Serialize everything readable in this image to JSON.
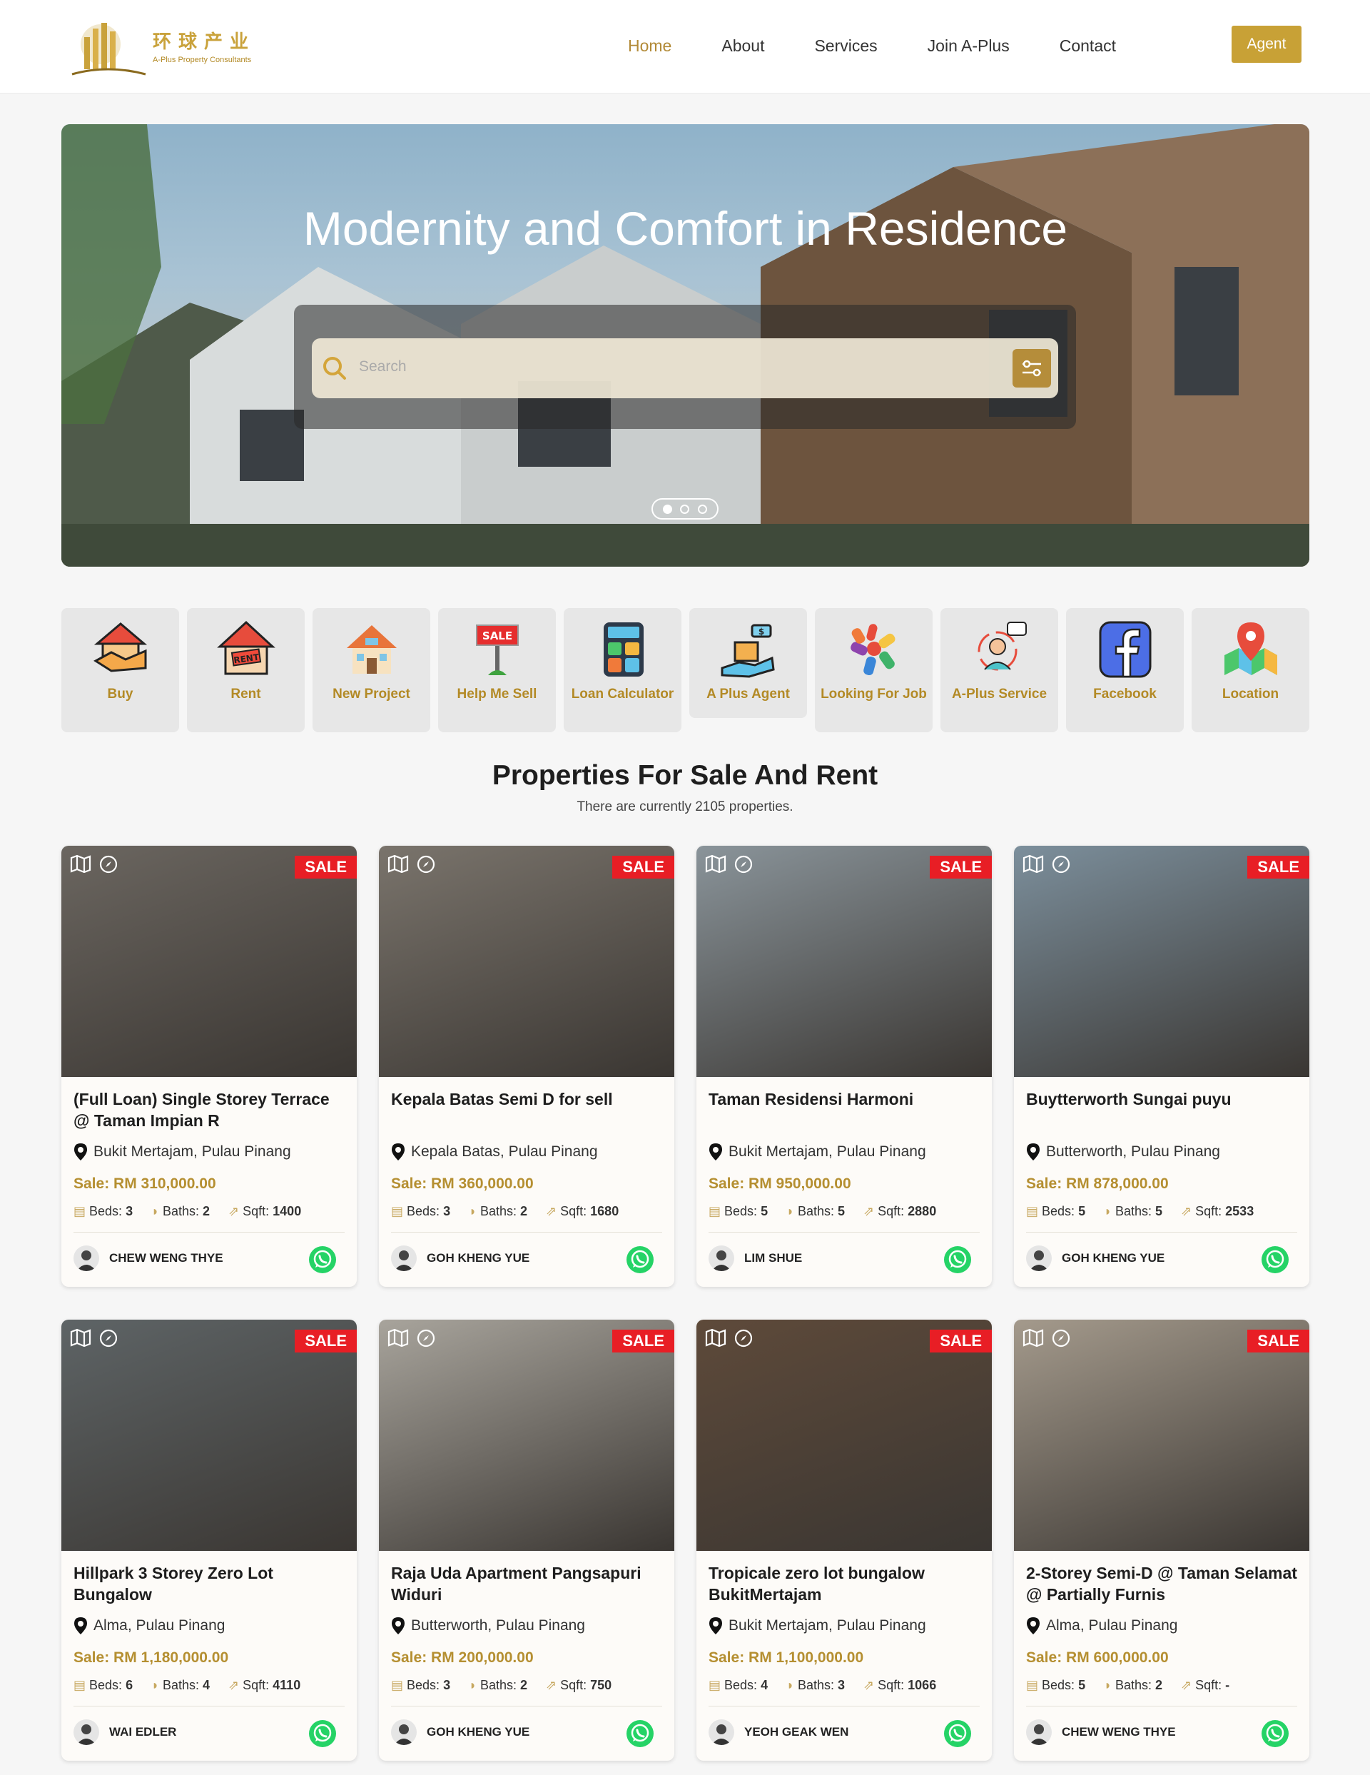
{
  "header": {
    "logo_cn": "环球产业",
    "logo_en": "A-Plus Property Consultants",
    "nav": [
      "Home",
      "About",
      "Services",
      "Join A-Plus",
      "Contact"
    ],
    "agent_button": "Agent"
  },
  "hero": {
    "title": "Modernity and Comfort in Residence",
    "search_placeholder": "Search"
  },
  "categories": [
    {
      "label": "Buy",
      "icon": "buy-icon"
    },
    {
      "label": "Rent",
      "icon": "rent-icon"
    },
    {
      "label": "New Project",
      "icon": "new-project-icon"
    },
    {
      "label": "Help Me Sell",
      "icon": "sale-sign-icon"
    },
    {
      "label": "Loan Calculator",
      "icon": "calculator-icon"
    },
    {
      "label": "A Plus Agent",
      "icon": "agent-icon"
    },
    {
      "label": "Looking For Job",
      "icon": "job-icon"
    },
    {
      "label": "A-Plus Service",
      "icon": "service-icon"
    },
    {
      "label": "Facebook",
      "icon": "facebook-icon"
    },
    {
      "label": "Location",
      "icon": "map-pin-icon"
    }
  ],
  "section": {
    "title": "Properties For Sale And Rent",
    "subtitle": "There are currently 2105 properties."
  },
  "listings": [
    {
      "tag": "SALE",
      "title": "(Full Loan) Single Storey Terrace @ Taman Impian R",
      "location": "Bukit Mertajam, Pulau Pinang",
      "price": "Sale: RM 310,000.00",
      "beds_label": "Beds:",
      "beds": "3",
      "baths_label": "Baths:",
      "baths": "2",
      "sqft_label": "Sqft:",
      "sqft": "1400",
      "agent": "CHEW WENG THYE",
      "img": "#6b6660"
    },
    {
      "tag": "SALE",
      "title": "Kepala Batas Semi D for sell",
      "location": "Kepala Batas, Pulau Pinang",
      "price": "Sale: RM 360,000.00",
      "beds_label": "Beds:",
      "beds": "3",
      "baths_label": "Baths:",
      "baths": "2",
      "sqft_label": "Sqft:",
      "sqft": "1680",
      "agent": "GOH KHENG YUE",
      "img": "#7a746c"
    },
    {
      "tag": "SALE",
      "title": "Taman Residensi Harmoni",
      "location": "Bukit Mertajam, Pulau Pinang",
      "price": "Sale: RM 950,000.00",
      "beds_label": "Beds:",
      "beds": "5",
      "baths_label": "Baths:",
      "baths": "5",
      "sqft_label": "Sqft:",
      "sqft": "2880",
      "agent": "LIM SHUE",
      "img": "#8a949a"
    },
    {
      "tag": "SALE",
      "title": "Buytterworth Sungai puyu",
      "location": "Butterworth, Pulau Pinang",
      "price": "Sale: RM 878,000.00",
      "beds_label": "Beds:",
      "beds": "5",
      "baths_label": "Baths:",
      "baths": "5",
      "sqft_label": "Sqft:",
      "sqft": "2533",
      "agent": "GOH KHENG YUE",
      "img": "#7c8f9c"
    },
    {
      "tag": "SALE",
      "title": "Hillpark 3 Storey Zero Lot Bungalow",
      "location": "Alma, Pulau Pinang",
      "price": "Sale: RM 1,180,000.00",
      "beds_label": "Beds:",
      "beds": "6",
      "baths_label": "Baths:",
      "baths": "4",
      "sqft_label": "Sqft:",
      "sqft": "4110",
      "agent": "WAI EDLER",
      "img": "#5e6466"
    },
    {
      "tag": "SALE",
      "title": "Raja Uda Apartment Pangsapuri Widuri",
      "location": "Butterworth, Pulau Pinang",
      "price": "Sale: RM 200,000.00",
      "beds_label": "Beds:",
      "beds": "3",
      "baths_label": "Baths:",
      "baths": "2",
      "sqft_label": "Sqft:",
      "sqft": "750",
      "agent": "GOH KHENG YUE",
      "img": "#a8a49c"
    },
    {
      "tag": "SALE",
      "title": "Tropicale zero lot bungalow BukitMertajam",
      "location": "Bukit Mertajam, Pulau Pinang",
      "price": "Sale: RM 1,100,000.00",
      "beds_label": "Beds:",
      "beds": "4",
      "baths_label": "Baths:",
      "baths": "3",
      "sqft_label": "Sqft:",
      "sqft": "1066",
      "agent": "YEOH GEAK WEN",
      "img": "#5e4a3a"
    },
    {
      "tag": "SALE",
      "title": "2-Storey Semi-D @ Taman Selamat @ Partially Furnis",
      "location": "Alma, Pulau Pinang",
      "price": "Sale: RM 600,000.00",
      "beds_label": "Beds:",
      "beds": "5",
      "baths_label": "Baths:",
      "baths": "2",
      "sqft_label": "Sqft:",
      "sqft": "-",
      "agent": "CHEW WENG THYE",
      "img": "#a49a8c"
    }
  ],
  "colors": {
    "accent": "#c8a136",
    "sale": "#e81e25",
    "whatsapp": "#25d366"
  }
}
